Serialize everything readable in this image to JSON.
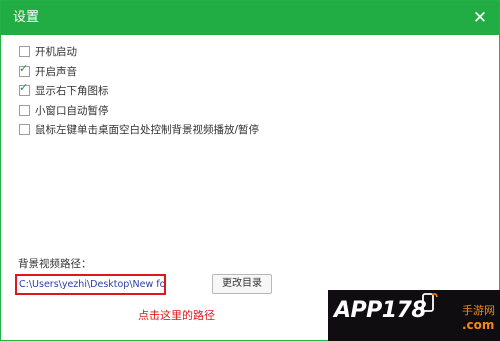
{
  "window": {
    "title": "设置",
    "close_label": "✕"
  },
  "options": [
    {
      "label": "开机启动",
      "checked": false
    },
    {
      "label": "开启声音",
      "checked": true
    },
    {
      "label": "显示右下角图标",
      "checked": true
    },
    {
      "label": "小窗口自动暂停",
      "checked": false
    },
    {
      "label": "鼠标左键单击桌面空白处控制背景视频播放/暂停",
      "checked": false
    }
  ],
  "video_path": {
    "label": "背景视频路径：",
    "value": "C:\\Users\\yezhi\\Desktop\\New folder"
  },
  "buttons": {
    "change_dir": "更改目录"
  },
  "annotation": "点击这里的路径",
  "watermark": {
    "main": "APP178",
    "side": "手游网",
    "com": ".com"
  },
  "colors": {
    "titlebar": "#22ad44",
    "highlight_border": "#e0151f",
    "annotation_text": "#e1191e",
    "watermark_accent": "#f28a18"
  },
  "icons": {
    "close": "close-icon",
    "check": "checkmark-icon",
    "watermark": "phone-icon"
  }
}
